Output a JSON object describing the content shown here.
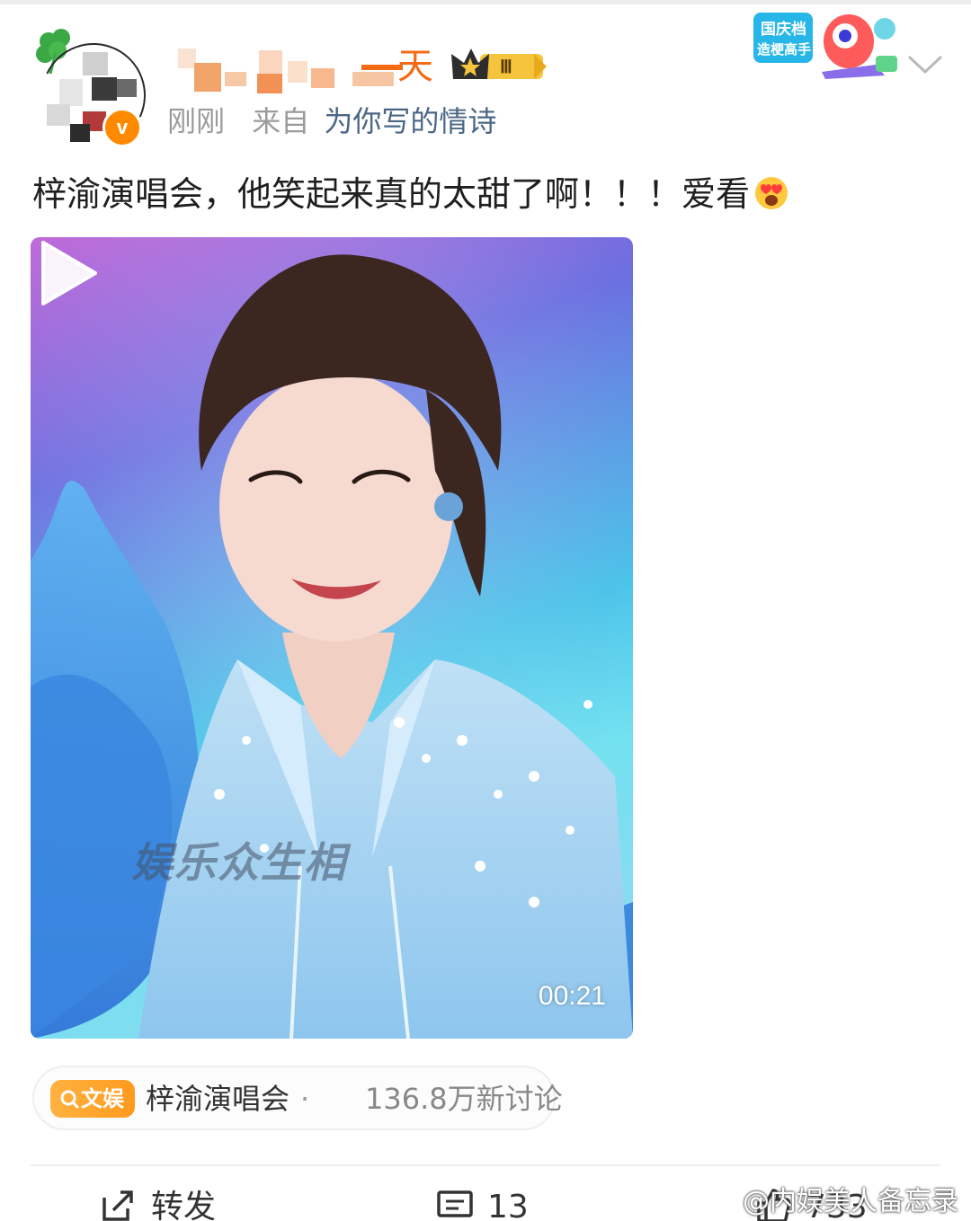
{
  "post": {
    "username_suffix": "天",
    "badge_level": "Ⅲ",
    "verified_mark": "v",
    "time": "刚刚",
    "from_label": "来自",
    "source": "为你写的情诗",
    "text": "梓渝演唱会，他笑起来真的太甜了啊！！！爱看",
    "emoji": "heart-eyes-emoji"
  },
  "promo_badge": {
    "line1": "国庆档",
    "line2": "造梗高手"
  },
  "video": {
    "watermark": "娱乐众生相",
    "duration": "00:21"
  },
  "topic": {
    "tag": "文娱",
    "name": "梓渝演唱会",
    "separator": "·",
    "count": "136.8万新讨论"
  },
  "actions": {
    "repost_label": "转发",
    "comment_count": "13",
    "like_count": "733"
  },
  "watermark": {
    "text": "@内娱美人备忘录"
  },
  "colors": {
    "username": "#f36b14",
    "source_link": "#4a6785",
    "topic_tag": "#ff9a1e",
    "meta_gray": "#9b9b9b"
  }
}
